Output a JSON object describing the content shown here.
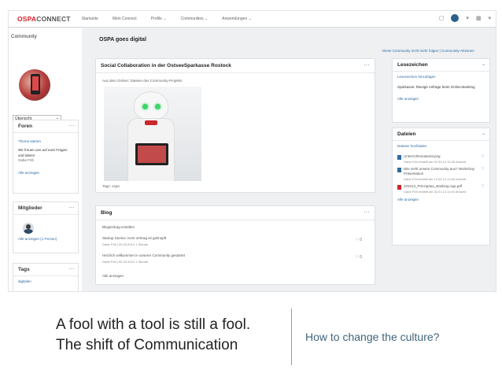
{
  "topbar": {
    "logo_part1": "OSPA",
    "logo_part2": "CONNECT",
    "nav": [
      "Startseite",
      "Mein Connect",
      "Profile",
      "Communities",
      "Anwendungen"
    ]
  },
  "left": {
    "title": "Community",
    "select_value": "Übersicht",
    "foren": {
      "title": "Foren",
      "link_top": "Thema starten",
      "text": "Wir freuen uns auf eure Fragen und Ideen!",
      "author": "Gabe Föh",
      "all": "Alle anzeigen"
    },
    "members": {
      "title": "Mitglieder",
      "all": "Alle anzeigen (1 Person)"
    },
    "tags": {
      "title": "Tags",
      "item": "digitalen"
    }
  },
  "center": {
    "title": "OSPA goes digital",
    "post": {
      "title": "Social Collaboration in der OstseeSparkasse Rostock",
      "subtitle": "Aus dem Ordner: Dateien des Community-Projekts",
      "footer": "Tags: ospa"
    },
    "blog": {
      "title": "Blog",
      "new_entry": "Blogeintrag erstellen",
      "entries": [
        {
          "title": "Startup Stories: Kein Vertrag ist geknüpft",
          "meta": "Gabe Föh  | 09.03.2014  1 Stunde",
          "likes": "0"
        },
        {
          "title": "Herzlich willkommen in unserer Community gestartet",
          "meta": "Gabe Föh  | 05.03.2014  1 Stunde",
          "likes": "0"
        }
      ],
      "all": "Alle anzeigen"
    }
  },
  "right": {
    "follow": "Diese Community nicht mehr folgen | Community-Aktionen",
    "bookmarks": {
      "title": "Lesezeichen",
      "add": "Lesezeichen hinzufügen",
      "item": "Sparkasse: Riesige Anfrage beim Online-Banking",
      "all": "Alle anzeigen"
    },
    "files": {
      "title": "Dateien",
      "upload": "Dateien hochladen",
      "items": [
        {
          "name": "Unterrichtsmaterial.png",
          "meta": "Gabe Föh erstellt am 02.03.14 13:40  Ansicht"
        },
        {
          "name": "Wie sieht unsere Community aus? Workshop Präsentation",
          "meta": "Gabe Föh erstellt am 14.04.14 13:40  Ansicht"
        },
        {
          "name": "231013_Prinzipdua_Banking App.pdf",
          "meta": "Gabe Föh erstellt am 02.01.14 11:40  Ansicht"
        }
      ],
      "all": "Alle anzeigen"
    }
  },
  "caption": {
    "line1": "A fool with a tool is still a fool.",
    "line2": "The shift of Communication",
    "question": "How to change the culture?"
  }
}
